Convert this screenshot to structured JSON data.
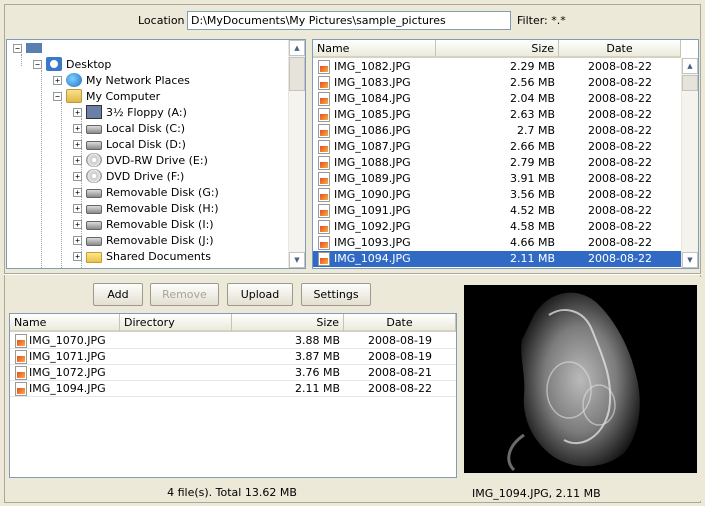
{
  "location": {
    "label": "Location",
    "value": "D:\\MyDocuments\\My Pictures\\sample_pictures"
  },
  "filter": {
    "label": "Filter: *.*"
  },
  "tree": {
    "items": [
      {
        "label": "Desktop",
        "icon": "desktop-icon"
      },
      {
        "label": "My Network Places",
        "icon": "network-places-icon"
      },
      {
        "label": "My Computer",
        "icon": "my-computer-icon"
      },
      {
        "label": "3½ Floppy (A:)",
        "icon": "floppy-icon"
      },
      {
        "label": "Local Disk (C:)",
        "icon": "hard-disk-icon"
      },
      {
        "label": "Local Disk (D:)",
        "icon": "hard-disk-icon"
      },
      {
        "label": "DVD-RW Drive (E:)",
        "icon": "dvd-drive-icon"
      },
      {
        "label": "DVD Drive (F:)",
        "icon": "dvd-drive-icon"
      },
      {
        "label": "Removable Disk (G:)",
        "icon": "removable-disk-icon"
      },
      {
        "label": "Removable Disk (H:)",
        "icon": "removable-disk-icon"
      },
      {
        "label": "Removable Disk (I:)",
        "icon": "removable-disk-icon"
      },
      {
        "label": "Removable Disk (J:)",
        "icon": "removable-disk-icon"
      },
      {
        "label": "Shared Documents",
        "icon": "folder-icon"
      }
    ]
  },
  "filelist": {
    "headers": {
      "name": "Name",
      "size": "Size",
      "date": "Date"
    },
    "rows": [
      {
        "name": "IMG_1082.JPG",
        "size": "2.29 MB",
        "date": "2008-08-22"
      },
      {
        "name": "IMG_1083.JPG",
        "size": "2.56 MB",
        "date": "2008-08-22"
      },
      {
        "name": "IMG_1084.JPG",
        "size": "2.04 MB",
        "date": "2008-08-22"
      },
      {
        "name": "IMG_1085.JPG",
        "size": "2.63 MB",
        "date": "2008-08-22"
      },
      {
        "name": "IMG_1086.JPG",
        "size": "2.7 MB",
        "date": "2008-08-22"
      },
      {
        "name": "IMG_1087.JPG",
        "size": "2.66 MB",
        "date": "2008-08-22"
      },
      {
        "name": "IMG_1088.JPG",
        "size": "2.79 MB",
        "date": "2008-08-22"
      },
      {
        "name": "IMG_1089.JPG",
        "size": "3.91 MB",
        "date": "2008-08-22"
      },
      {
        "name": "IMG_1090.JPG",
        "size": "3.56 MB",
        "date": "2008-08-22"
      },
      {
        "name": "IMG_1091.JPG",
        "size": "4.52 MB",
        "date": "2008-08-22"
      },
      {
        "name": "IMG_1092.JPG",
        "size": "4.58 MB",
        "date": "2008-08-22"
      },
      {
        "name": "IMG_1093.JPG",
        "size": "4.66 MB",
        "date": "2008-08-22"
      },
      {
        "name": "IMG_1094.JPG",
        "size": "2.11 MB",
        "date": "2008-08-22"
      }
    ]
  },
  "buttons": {
    "add": "Add",
    "remove": "Remove",
    "upload": "Upload",
    "settings": "Settings"
  },
  "queue": {
    "headers": {
      "name": "Name",
      "directory": "Directory",
      "size": "Size",
      "date": "Date"
    },
    "rows": [
      {
        "name": "IMG_1070.JPG",
        "directory": "",
        "size": "3.88 MB",
        "date": "2008-08-19"
      },
      {
        "name": "IMG_1071.JPG",
        "directory": "",
        "size": "3.87 MB",
        "date": "2008-08-19"
      },
      {
        "name": "IMG_1072.JPG",
        "directory": "",
        "size": "3.76 MB",
        "date": "2008-08-21"
      },
      {
        "name": "IMG_1094.JPG",
        "directory": "",
        "size": "2.11 MB",
        "date": "2008-08-22"
      }
    ]
  },
  "status": {
    "text": "4 file(s). Total 13.62 MB"
  },
  "preview": {
    "caption": "IMG_1094.JPG, 2.11 MB"
  },
  "colors": {
    "selection": "#316ac5",
    "face": "#ECE9D8",
    "border": "#7f9db9"
  }
}
